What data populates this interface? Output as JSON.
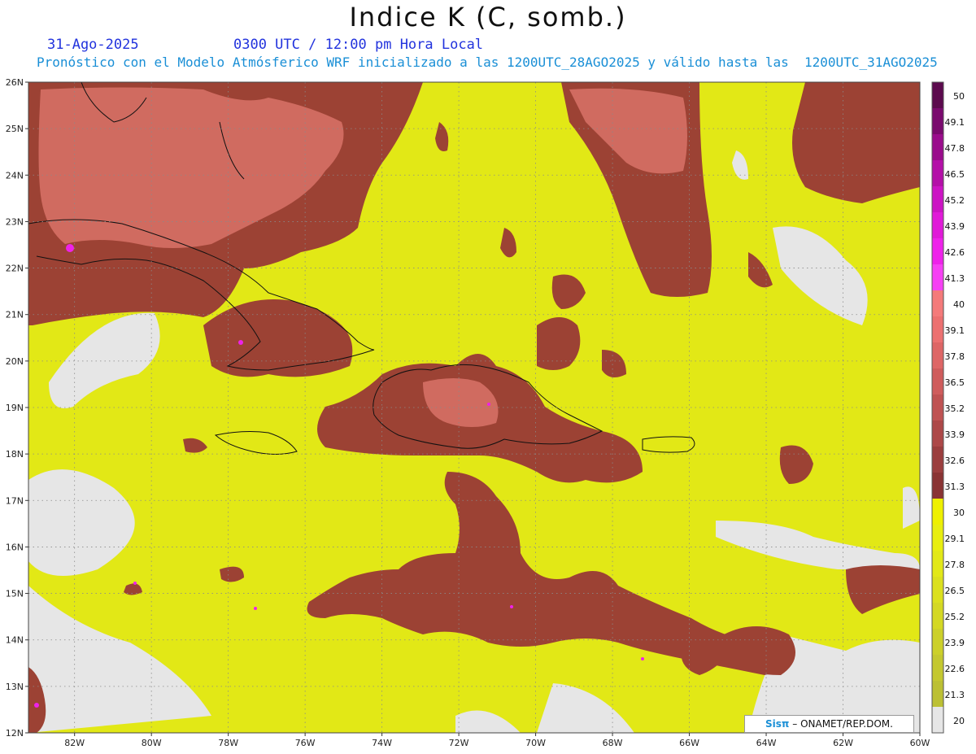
{
  "title": "Indice K (C, somb.)",
  "header": {
    "date": "31-Ago-2025",
    "time": "0300 UTC / 12:00 pm Hora Local",
    "info": "Pronóstico con el Modelo Atmósferico WRF inicializado a las 1200UTC_28AGO2025 y válido hasta las  1200UTC_31AGO2025"
  },
  "map": {
    "lat_ticks": [
      "26N",
      "25N",
      "24N",
      "23N",
      "22N",
      "21N",
      "20N",
      "19N",
      "18N",
      "17N",
      "16N",
      "15N",
      "14N",
      "13N",
      "12N"
    ],
    "lon_ticks": [
      "82W",
      "80W",
      "78W",
      "76W",
      "74W",
      "72W",
      "70W",
      "68W",
      "66W",
      "64W",
      "62W",
      "60W"
    ],
    "lat_range": [
      12,
      26
    ],
    "lon_range": [
      -83.2,
      -60
    ],
    "grid": "dotted"
  },
  "colorbar": {
    "labels": [
      "50",
      "49.1",
      "47.8",
      "46.5",
      "45.2",
      "43.9",
      "42.6",
      "41.3",
      "40",
      "39.1",
      "37.8",
      "36.5",
      "35.2",
      "33.9",
      "32.6",
      "31.3",
      "30",
      "29.1",
      "27.8",
      "26.5",
      "25.2",
      "23.9",
      "22.6",
      "21.3",
      "20"
    ],
    "colors": [
      "#5c0a4e",
      "#7a0a6e",
      "#9a0c8c",
      "#b410a8",
      "#cc14c4",
      "#e01ad8",
      "#ee22ea",
      "#f640f4",
      "#f47a7a",
      "#ec7070",
      "#de6666",
      "#cf5c5c",
      "#bf5252",
      "#ad4848",
      "#9b3e3e",
      "#8a3434",
      "#eef000",
      "#e8ee10",
      "#e2e818",
      "#dbe01e",
      "#d4d824",
      "#ccd02a",
      "#c4c830",
      "#bcc034",
      "#e6e6e6"
    ]
  },
  "credit": {
    "brand": "Sisπ",
    "text": "– ONAMET/REP.DOM."
  }
}
